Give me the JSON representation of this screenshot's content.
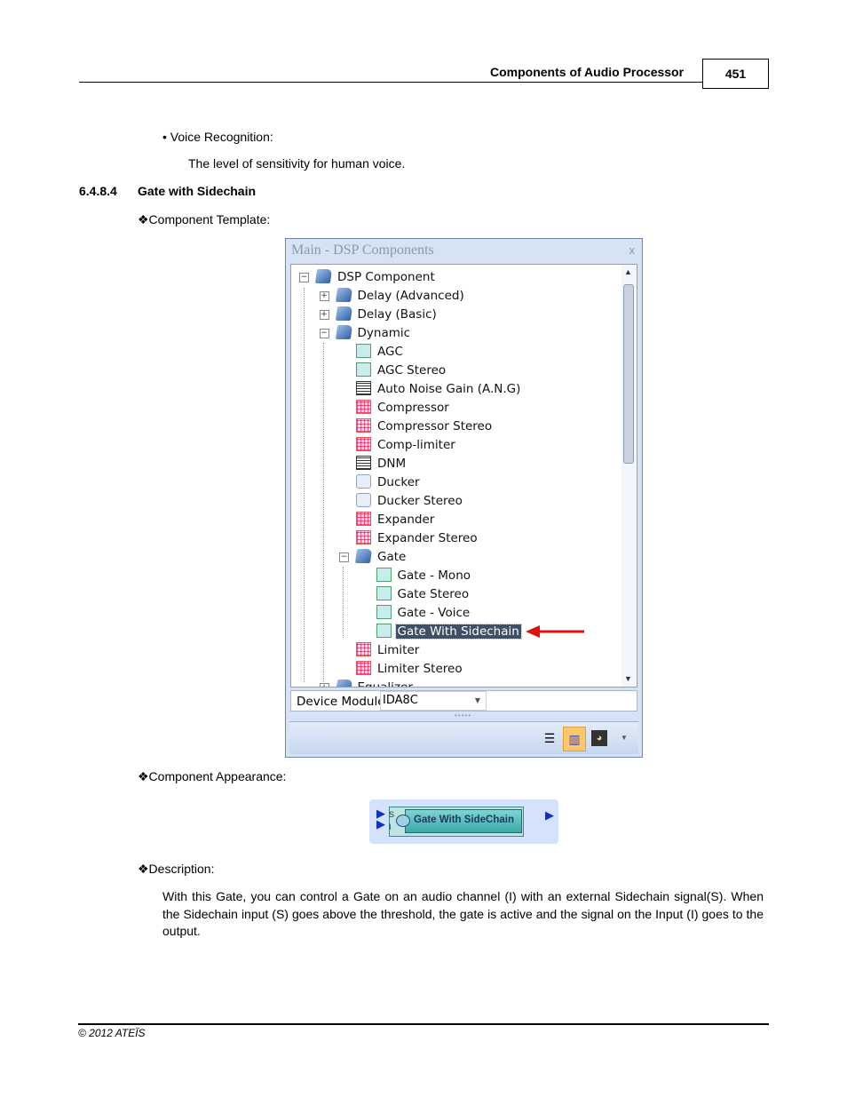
{
  "header": {
    "title": "Components of Audio Processor",
    "page_number": "451"
  },
  "body": {
    "bullet": "Voice Recognition:",
    "bullet_desc": "The level of sensitivity for human voice.",
    "section_number": "6.4.8.4",
    "section_title": "Gate with Sidechain",
    "template_label": "❖Component Template:",
    "appearance_label": "❖Component Appearance:",
    "description_label": "❖Description:",
    "description": "With this Gate, you can control a Gate on an audio channel (I) with an external Sidechain signal(S). When the Sidechain input (S) goes above the threshold, the gate is active and the signal on the Input (I) goes to the output."
  },
  "panel": {
    "title": "Main - DSP Components",
    "close": "x",
    "tree": [
      {
        "label": "DSP Component",
        "level": 0,
        "icon": "folder-open-icon",
        "expander": "minus"
      },
      {
        "label": "Delay (Advanced)",
        "level": 1,
        "icon": "folder-icon",
        "expander": "plus"
      },
      {
        "label": "Delay (Basic)",
        "level": 1,
        "icon": "folder-icon",
        "expander": "plus"
      },
      {
        "label": "Dynamic",
        "level": 1,
        "icon": "folder-open-icon",
        "expander": "minus"
      },
      {
        "label": "AGC",
        "level": 2,
        "icon": "gate-icon"
      },
      {
        "label": "AGC Stereo",
        "level": 2,
        "icon": "gate-icon"
      },
      {
        "label": "Auto Noise Gain (A.N.G)",
        "level": 2,
        "icon": "ang-icon"
      },
      {
        "label": "Compressor",
        "level": 2,
        "icon": "compressor-icon"
      },
      {
        "label": "Compressor Stereo",
        "level": 2,
        "icon": "compressor-icon"
      },
      {
        "label": "Comp-limiter",
        "level": 2,
        "icon": "compressor-icon"
      },
      {
        "label": "DNM",
        "level": 2,
        "icon": "ang-icon"
      },
      {
        "label": "Ducker",
        "level": 2,
        "icon": "ducker-icon"
      },
      {
        "label": "Ducker Stereo",
        "level": 2,
        "icon": "ducker-icon"
      },
      {
        "label": "Expander",
        "level": 2,
        "icon": "compressor-icon"
      },
      {
        "label": "Expander Stereo",
        "level": 2,
        "icon": "compressor-icon"
      },
      {
        "label": "Gate",
        "level": 2,
        "icon": "folder-open-icon",
        "expander": "minus"
      },
      {
        "label": "Gate - Mono",
        "level": 3,
        "icon": "gate-icon"
      },
      {
        "label": "Gate Stereo",
        "level": 3,
        "icon": "gate-icon"
      },
      {
        "label": "Gate - Voice",
        "level": 3,
        "icon": "gate-icon"
      },
      {
        "label": "Gate With Sidechain",
        "level": 3,
        "icon": "gate-icon",
        "selected": true
      },
      {
        "label": "Limiter",
        "level": 2,
        "icon": "compressor-icon"
      },
      {
        "label": "Limiter Stereo",
        "level": 2,
        "icon": "compressor-icon"
      },
      {
        "label": "Equalizer",
        "level": 1,
        "icon": "folder-icon",
        "expander": "plus"
      }
    ],
    "device_module_label": "Device Module",
    "device_module_value": "IDA8C",
    "arrow_color": "#e01010"
  },
  "appearance": {
    "label": "Gate With SideChain",
    "input_s": "S",
    "input_i": "I"
  },
  "footer": {
    "copyright": "© 2012 ATEÏS"
  }
}
